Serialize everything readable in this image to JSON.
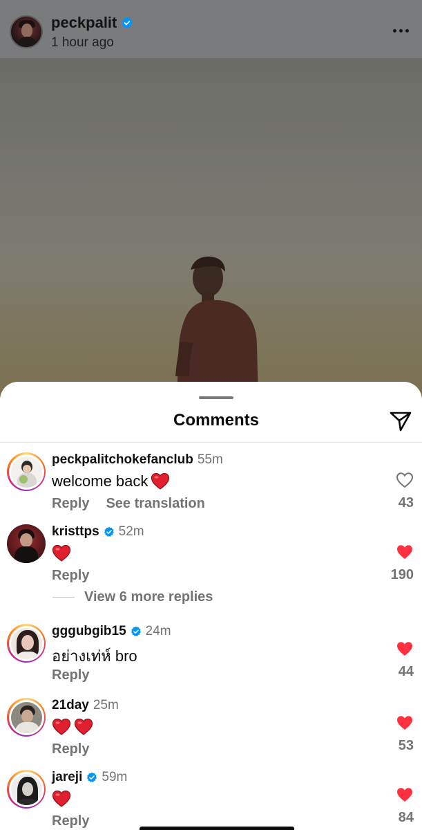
{
  "post": {
    "username": "peckpalit",
    "time": "1 hour ago"
  },
  "comments_sheet": {
    "title": "Comments",
    "view_more_replies": "View 6 more replies",
    "reply_label": "Reply",
    "translate_label": "See translation",
    "comments": [
      {
        "username": "peckpalitchokefanclub",
        "verified": false,
        "time": "55m",
        "text": "welcome back",
        "hearts": 1,
        "liked": false,
        "likes": "43"
      },
      {
        "username": "kristtps",
        "verified": true,
        "time": "52m",
        "text": "",
        "hearts": 1,
        "liked": true,
        "likes": "190"
      },
      {
        "username": "gggubgib15",
        "verified": true,
        "time": "24m",
        "text": "อย่างเท่ห์ bro",
        "hearts": 0,
        "liked": true,
        "likes": "44"
      },
      {
        "username": "21day",
        "verified": false,
        "time": "25m",
        "text": "",
        "hearts": 2,
        "liked": true,
        "likes": "53"
      },
      {
        "username": "jareji",
        "verified": true,
        "time": "59m",
        "text": "",
        "hearts": 1,
        "liked": true,
        "likes": "84"
      }
    ]
  },
  "colors": {
    "verified": "#0095f6",
    "heart": "#ff3040",
    "emoji_heart": "#e0202e",
    "muted_text": "#737373"
  },
  "icons": [
    "verified-badge-icon",
    "more-options-icon",
    "share-paper-plane-icon",
    "heart-outline-icon",
    "heart-filled-icon",
    "red-heart-emoji"
  ]
}
